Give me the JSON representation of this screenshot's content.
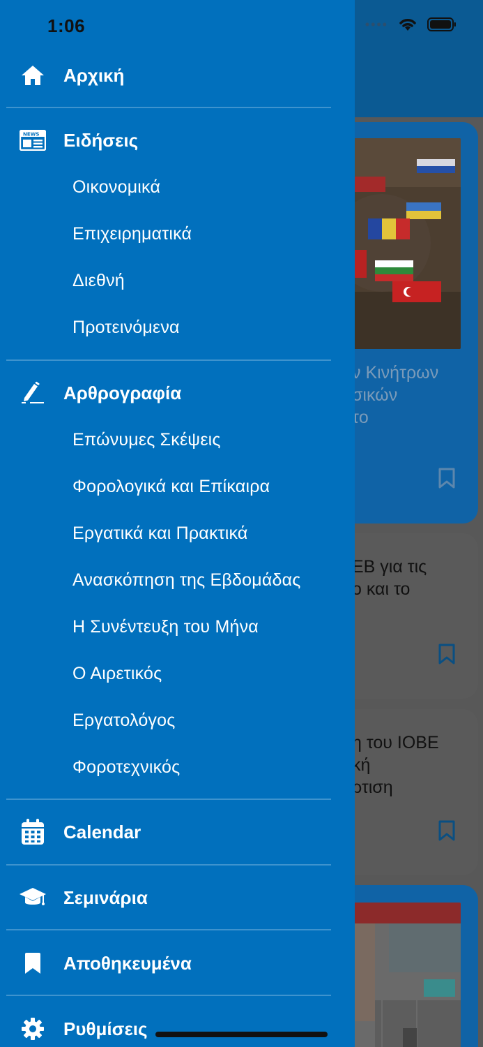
{
  "status_bar": {
    "time": "1:06"
  },
  "drawer": {
    "home": {
      "label": "Αρχική",
      "icon": "home-icon"
    },
    "news": {
      "label": "Ειδήσεις",
      "icon": "newspaper-icon",
      "items": [
        "Οικονομικά",
        "Επιχειρηματικά",
        "Διεθνή",
        "Προτεινόμενα"
      ]
    },
    "articles": {
      "label": "Αρθρογραφία",
      "icon": "pen-icon",
      "items": [
        "Επώνυμες Σκέψεις",
        "Φορολογικά και Επίκαιρα",
        "Εργατικά και Πρακτικά",
        "Ανασκόπηση της Εβδομάδας",
        "Η Συνέντευξη του Μήνα",
        "Ο Αιρετικός",
        "Εργατολόγος",
        "Φοροτεχνικός"
      ]
    },
    "calendar": {
      "label": "Calendar",
      "icon": "calendar-icon"
    },
    "seminars": {
      "label": "Σεμινάρια",
      "icon": "graduation-cap-icon"
    },
    "saved": {
      "label": "Αποθηκευμένα",
      "icon": "bookmark-icon"
    },
    "settings": {
      "label": "Ρυθμίσεις",
      "icon": "gear-icon"
    }
  },
  "background_feed": {
    "card1_text": [
      "ν Κινήτρων",
      "σικών",
      "τo"
    ],
    "card2_text": [
      "ΕΒ  για τις",
      "ο και το"
    ],
    "card3_text": [
      "η του ΙΟΒΕ",
      "κή",
      "ρτιση"
    ]
  },
  "colors": {
    "drawer": "#0170BD",
    "divider": "#3E93CE",
    "header": "#0B5A93"
  }
}
